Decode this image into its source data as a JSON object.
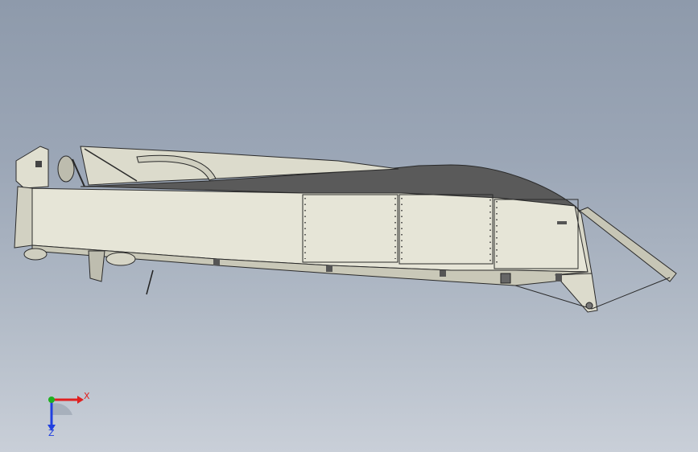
{
  "viewport": {
    "background_top": "#8e9aab",
    "background_bottom": "#c9cfd8"
  },
  "model": {
    "hull_color": "#e6e5d7",
    "hull_shade": "#c9c8b8",
    "deck_color": "#5b5b5b",
    "edge_color": "#2a2a2a"
  },
  "triad": {
    "x_label": "X",
    "z_label": "Z",
    "x_color": "#e02020",
    "y_color": "#20b020",
    "z_color": "#2040e0"
  }
}
